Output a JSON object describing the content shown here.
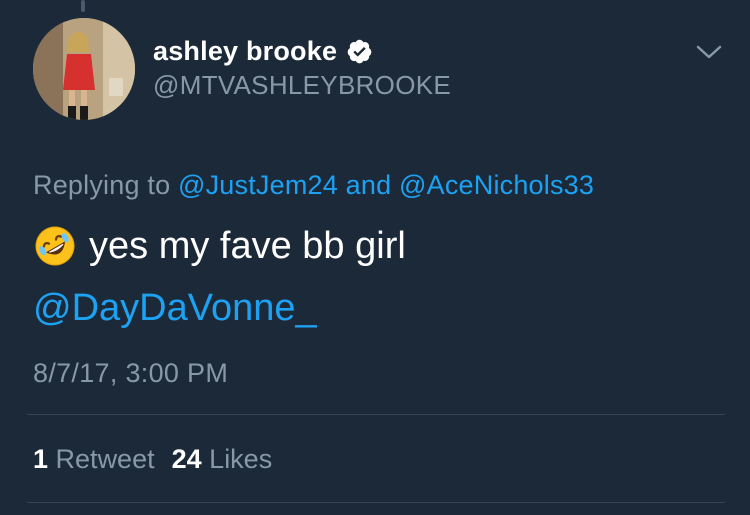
{
  "tweet": {
    "author": {
      "display_name": "ashley brooke",
      "handle": "@MTVASHLEYBROOKE",
      "verified": true,
      "avatar_icon": "profile-photo"
    },
    "replying_prefix": "Replying to",
    "replying_mention_1": "@JustJem24",
    "replying_and": "and",
    "replying_mention_2": "@AceNichols33",
    "emoji_icon": "rolling-on-floor-laughing-emoji",
    "text": "yes my fave bb girl",
    "mention": "@DayDaVonne_",
    "timestamp": "8/7/17, 3:00 PM",
    "retweets_count": "1",
    "retweets_label": "Retweet",
    "likes_count": "24",
    "likes_label": "Likes"
  },
  "colors": {
    "background": "#1c2938",
    "link": "#1da1f2",
    "secondary_text": "#8899a6",
    "primary_text": "#ffffff",
    "divider": "#38444d"
  }
}
